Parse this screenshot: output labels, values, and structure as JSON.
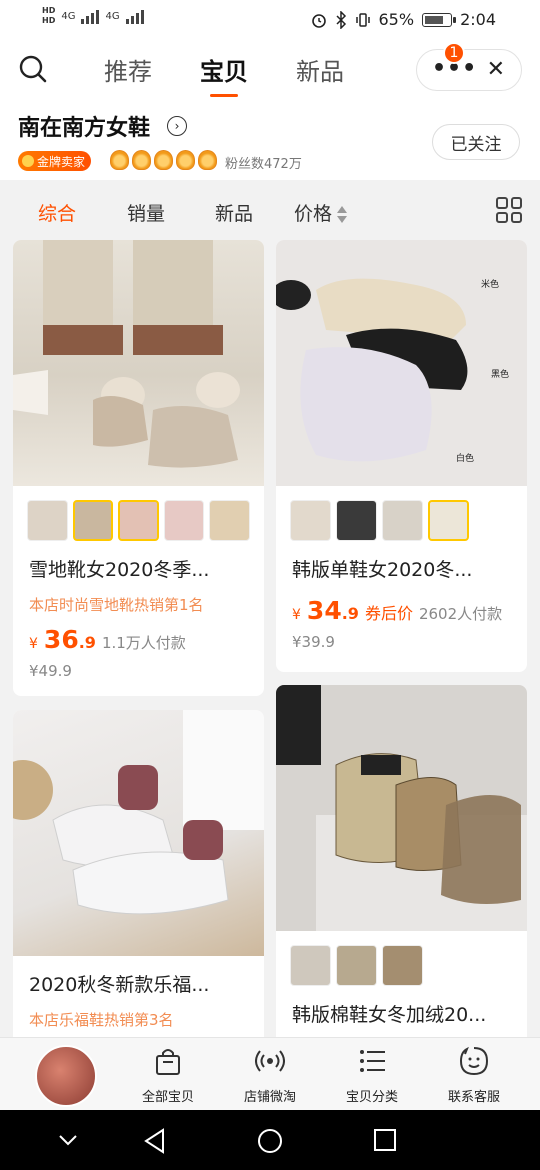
{
  "status_bar": {
    "network_hd": "HD",
    "network_1": "4G",
    "network_2": "4G",
    "battery": "65%",
    "time": "2:04"
  },
  "header": {
    "tabs": [
      {
        "label": "推荐",
        "active": false
      },
      {
        "label": "宝贝",
        "active": true
      },
      {
        "label": "新品",
        "active": false
      }
    ],
    "more_badge": "1",
    "more_symbol": "•••",
    "close_symbol": "✕"
  },
  "store": {
    "name": "南在南方女鞋",
    "gold_badge": "金牌卖家",
    "fans": "粉丝数472万",
    "follow_label": "已关注"
  },
  "filters": {
    "items": [
      "综合",
      "销量",
      "新品",
      "价格"
    ],
    "active": "综合"
  },
  "products": [
    {
      "title": "雪地靴女2020冬季...",
      "tag": "本店时尚雪地靴热销第1名",
      "currency": "¥",
      "price_int": "36",
      "price_dec": ".9",
      "sold": "1.1万人付款",
      "original": "¥49.9"
    },
    {
      "title": "韩版单鞋女2020冬...",
      "currency": "¥",
      "price_int": "34",
      "price_dec": ".9",
      "coupon": "券后价",
      "sold": "2602人付款",
      "original": "¥39.9",
      "image_labels": [
        "米色",
        "黑色",
        "白色"
      ]
    },
    {
      "title": "2020秋冬新款乐福...",
      "tag": "本店乐福鞋热销第3名"
    },
    {
      "title": "韩版棉鞋女冬加绒20..."
    }
  ],
  "bottom_nav": [
    {
      "label": "全部宝贝",
      "icon": "bag-icon"
    },
    {
      "label": "店铺微淘",
      "icon": "broadcast-icon"
    },
    {
      "label": "宝贝分类",
      "icon": "list-icon"
    },
    {
      "label": "联系客服",
      "icon": "chat-face-icon"
    }
  ],
  "colors": {
    "accent": "#ff5000",
    "tag": "#f28d53"
  }
}
